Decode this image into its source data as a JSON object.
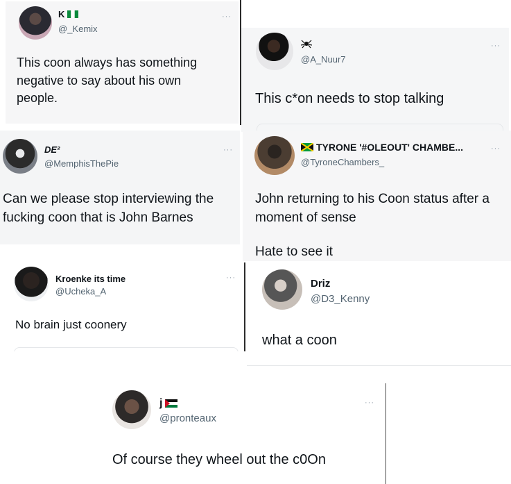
{
  "tweets": [
    {
      "name": "K",
      "handle": "@_Kemix",
      "text": "This coon always has something negative to say about his own people.",
      "flag": "nigeria-flag",
      "avatar": "avatar-photo"
    },
    {
      "name": "",
      "handle": "@A_Nuur7",
      "text": "This c*on needs to stop talking",
      "flag": "spider-icon",
      "avatar": "avatar-photo"
    },
    {
      "name": "DE²",
      "handle": "@MemphisThePie",
      "text": "Can we please stop interviewing the fucking coon that is John Barnes",
      "avatar": "avatar-photo"
    },
    {
      "name": "TYRONE '#OLEOUT' CHAMBE...",
      "handle": "@TyroneChambers_",
      "text": "John returning to his Coon status after a moment of sense",
      "text2": "Hate to see it",
      "flag": "jamaica-flag",
      "avatar": "avatar-photo"
    },
    {
      "name": "Kroenke its time",
      "handle": "@Ucheka_A",
      "text": "No brain just coonery",
      "avatar": "avatar-photo"
    },
    {
      "name": "Driz",
      "handle": "@D3_Kenny",
      "text": "what a coon",
      "avatar": "avatar-photo"
    },
    {
      "name": "j",
      "handle": "@pronteaux",
      "text": "Of course they wheel out the c0On",
      "flag": "palestine-flag",
      "avatar": "avatar-photo"
    }
  ],
  "more_glyph": "···"
}
